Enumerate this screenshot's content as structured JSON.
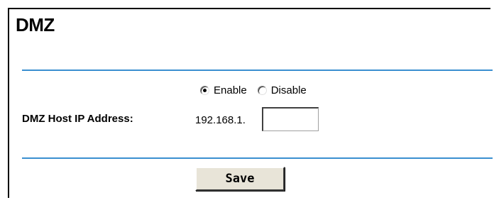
{
  "page": {
    "title": "DMZ"
  },
  "dmz": {
    "status_options": [
      {
        "label": "Enable",
        "selected": true
      },
      {
        "label": "Disable",
        "selected": false
      }
    ],
    "host_ip_label": "DMZ Host IP Address:",
    "host_ip_prefix": "192.168.1.",
    "host_ip_last_octet": ""
  },
  "actions": {
    "save_label": "Save"
  },
  "colors": {
    "divider": "#3a8fd0",
    "button_face": "#e8e4d8"
  }
}
